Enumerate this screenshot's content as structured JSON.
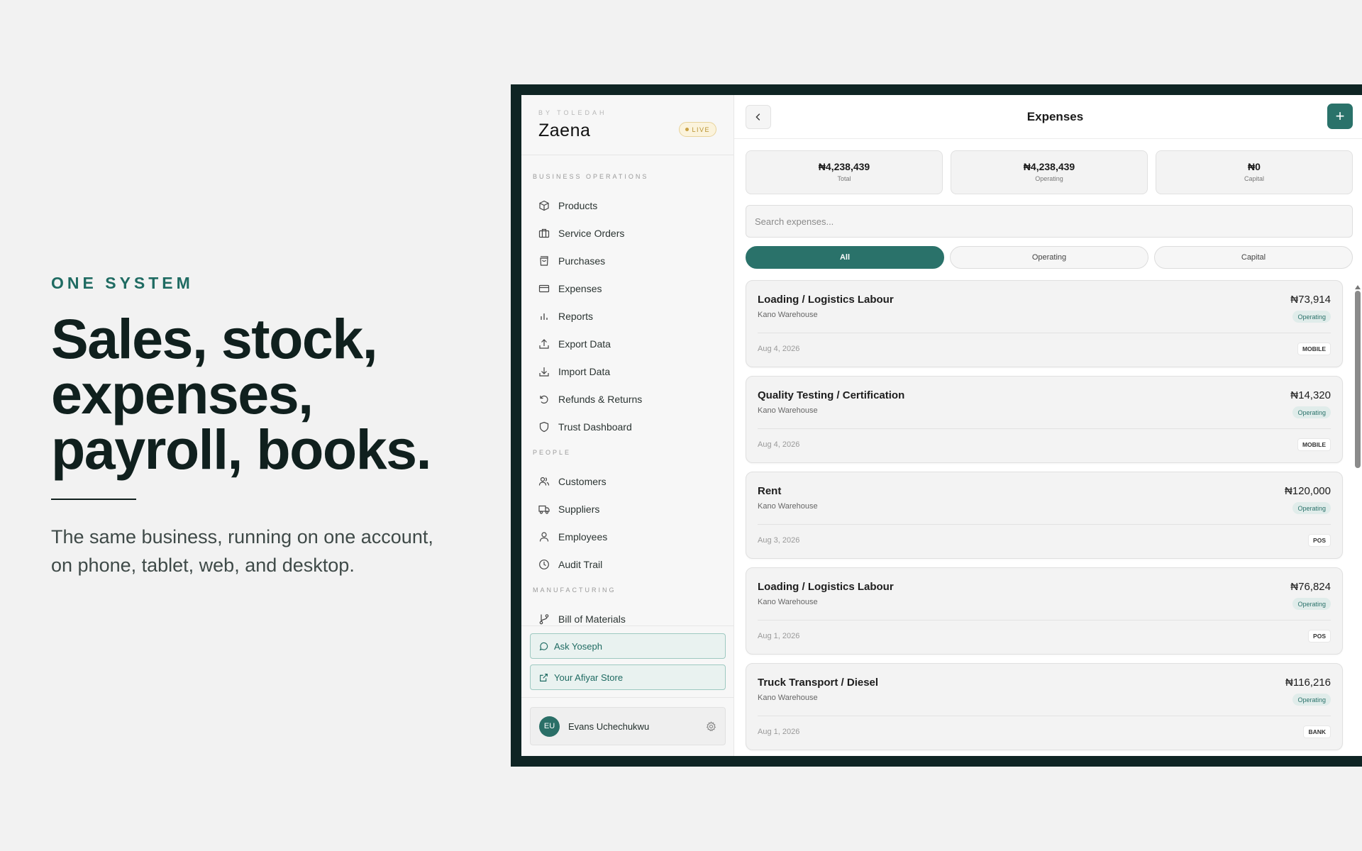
{
  "hero": {
    "eyebrow": "ONE SYSTEM",
    "headline_lines": [
      "Sales, stock,",
      "expenses,",
      "payroll, books."
    ],
    "subtext_lines": [
      "The same business, running on one account,",
      "on phone, tablet, web, and desktop."
    ]
  },
  "sidebar": {
    "brand_by": "BY TOLEDAH",
    "brand_name": "Zaena",
    "live_label": "LIVE",
    "sections": [
      {
        "label": "BUSINESS OPERATIONS",
        "items": [
          {
            "label": "Products",
            "icon": "box-icon"
          },
          {
            "label": "Service Orders",
            "icon": "briefcase-icon"
          },
          {
            "label": "Purchases",
            "icon": "shopping-bag-icon"
          },
          {
            "label": "Expenses",
            "icon": "credit-card-icon"
          },
          {
            "label": "Reports",
            "icon": "bar-chart-icon"
          },
          {
            "label": "Export Data",
            "icon": "upload-icon"
          },
          {
            "label": "Import Data",
            "icon": "download-icon"
          },
          {
            "label": "Refunds & Returns",
            "icon": "rotate-ccw-icon"
          },
          {
            "label": "Trust Dashboard",
            "icon": "shield-icon"
          }
        ]
      },
      {
        "label": "PEOPLE",
        "items": [
          {
            "label": "Customers",
            "icon": "users-icon"
          },
          {
            "label": "Suppliers",
            "icon": "truck-icon"
          },
          {
            "label": "Employees",
            "icon": "user-icon"
          },
          {
            "label": "Audit Trail",
            "icon": "clock-icon"
          }
        ]
      },
      {
        "label": "MANUFACTURING",
        "items": [
          {
            "label": "Bill of Materials",
            "icon": "git-branch-icon"
          }
        ]
      }
    ],
    "ask_label": "Ask Yoseph",
    "store_label": "Your Afiyar Store",
    "user": {
      "initials": "EU",
      "name": "Evans Uchechukwu"
    }
  },
  "main": {
    "title": "Expenses",
    "stats": [
      {
        "value": "₦4,238,439",
        "label": "Total"
      },
      {
        "value": "₦4,238,439",
        "label": "Operating"
      },
      {
        "value": "₦0",
        "label": "Capital"
      }
    ],
    "search_placeholder": "Search expenses...",
    "filters": [
      {
        "label": "All",
        "active": true
      },
      {
        "label": "Operating",
        "active": false
      },
      {
        "label": "Capital",
        "active": false
      }
    ],
    "expenses": [
      {
        "name": "Loading / Logistics Labour",
        "location": "Kano Warehouse",
        "amount": "₦73,914",
        "type": "Operating",
        "date": "Aug 4, 2026",
        "channel": "MOBILE"
      },
      {
        "name": "Quality Testing / Certification",
        "location": "Kano Warehouse",
        "amount": "₦14,320",
        "type": "Operating",
        "date": "Aug 4, 2026",
        "channel": "MOBILE"
      },
      {
        "name": "Rent",
        "location": "Kano Warehouse",
        "amount": "₦120,000",
        "type": "Operating",
        "date": "Aug 3, 2026",
        "channel": "POS"
      },
      {
        "name": "Loading / Logistics Labour",
        "location": "Kano Warehouse",
        "amount": "₦76,824",
        "type": "Operating",
        "date": "Aug 1, 2026",
        "channel": "POS"
      },
      {
        "name": "Truck Transport / Diesel",
        "location": "Kano Warehouse",
        "amount": "₦116,216",
        "type": "Operating",
        "date": "Aug 1, 2026",
        "channel": "BANK"
      }
    ]
  },
  "colors": {
    "accent": "#2a726a",
    "frame": "#0f2524",
    "live": "#b8912f"
  }
}
